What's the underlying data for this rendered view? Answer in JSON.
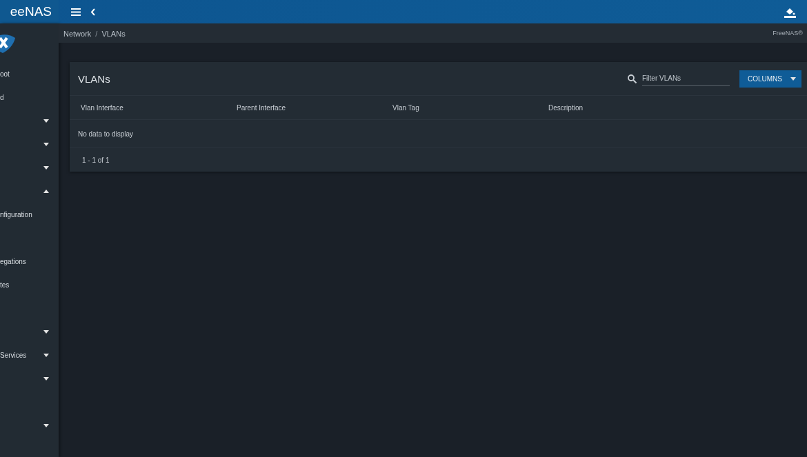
{
  "topbar": {
    "brand": "eeNAS"
  },
  "breadcrumb": [
    {
      "label": "Network"
    },
    {
      "label": "VLANs"
    }
  ],
  "breadcrumb_separator": "/",
  "copyright": "FreeNAS®",
  "sidebar": {
    "items": [
      {
        "kind": "link",
        "label": "oot"
      },
      {
        "kind": "link",
        "label": "d"
      },
      {
        "kind": "group",
        "expanded": false
      },
      {
        "kind": "group",
        "expanded": false
      },
      {
        "kind": "group",
        "expanded": false
      },
      {
        "kind": "group",
        "expanded": true
      },
      {
        "kind": "link",
        "label": "nfiguration"
      },
      {
        "kind": "link"
      },
      {
        "kind": "link",
        "label": "egations"
      },
      {
        "kind": "link",
        "label": "tes"
      },
      {
        "kind": "link"
      },
      {
        "kind": "group",
        "expanded": false
      },
      {
        "kind": "group",
        "label": "Services",
        "expanded": false
      },
      {
        "kind": "group",
        "expanded": false
      },
      {
        "kind": "link"
      },
      {
        "kind": "group",
        "expanded": false
      }
    ]
  },
  "card": {
    "title": "VLANs",
    "filter": {
      "placeholder": "Filter VLANs"
    },
    "columns_button": "COLUMNS",
    "table": {
      "columns": [
        "Vlan Interface",
        "Parent Interface",
        "Vlan Tag",
        "Description"
      ],
      "empty": "No data to display",
      "pager": "1 - 1 of 1"
    }
  }
}
